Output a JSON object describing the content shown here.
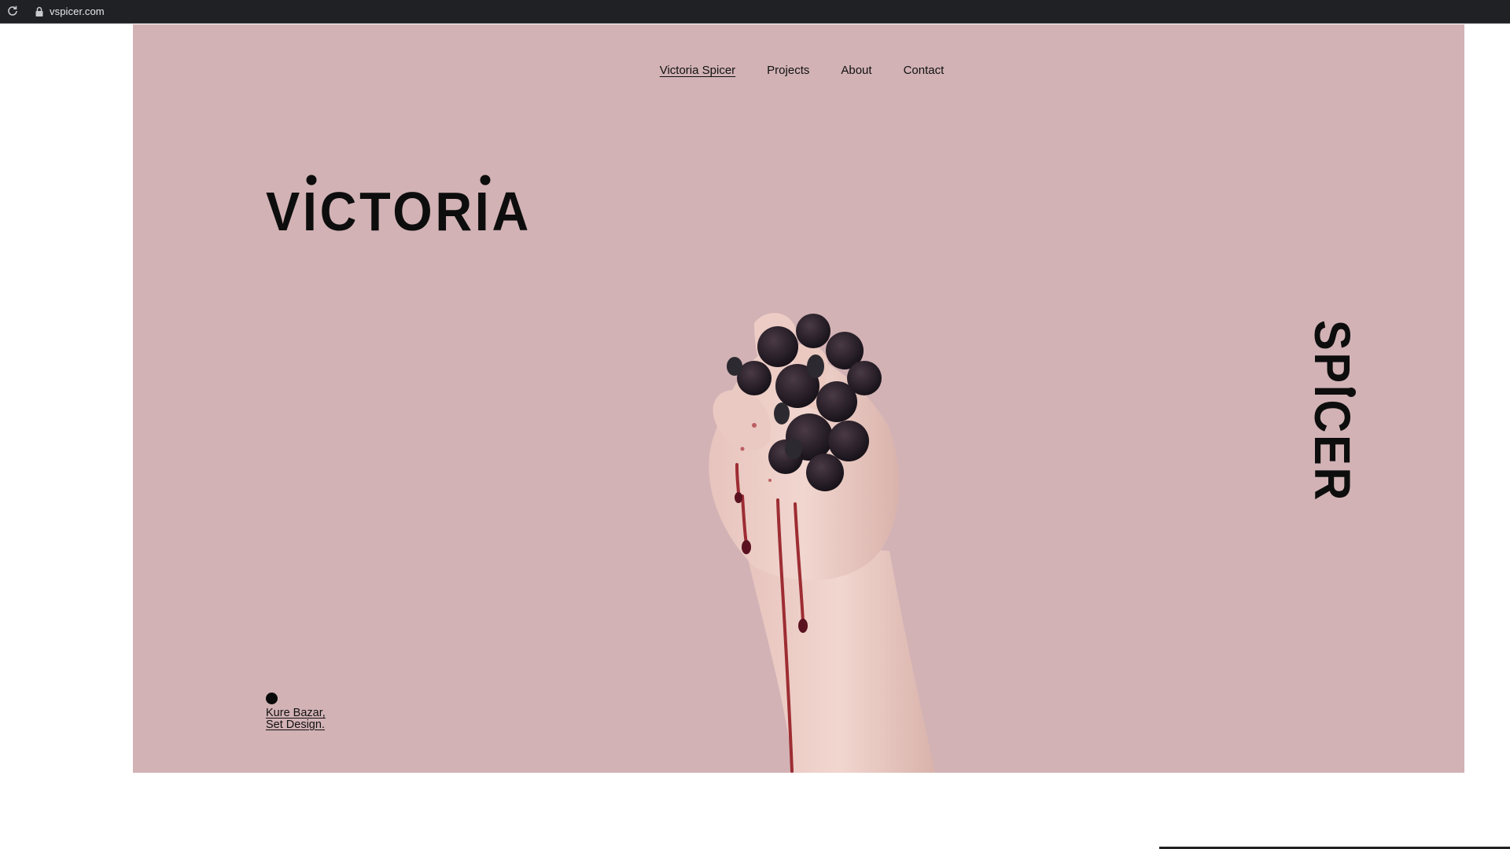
{
  "browser": {
    "url": "vspicer.com",
    "reload_icon": "reload-icon",
    "lock_icon": "lock-icon"
  },
  "colors": {
    "hero_background": "#d2b2b5",
    "text": "#111111",
    "browser_bar": "#202124"
  },
  "nav": {
    "items": [
      {
        "label": "Victoria Spicer",
        "active": true
      },
      {
        "label": "Projects",
        "active": false
      },
      {
        "label": "About",
        "active": false
      },
      {
        "label": "Contact",
        "active": false
      }
    ]
  },
  "hero": {
    "first_name": "VICTORIA",
    "last_name": "SPICER",
    "photo": "hand-crushing-blackberries-image"
  },
  "caption": {
    "line1": "Kure Bazar,",
    "line2": "Set Design."
  }
}
